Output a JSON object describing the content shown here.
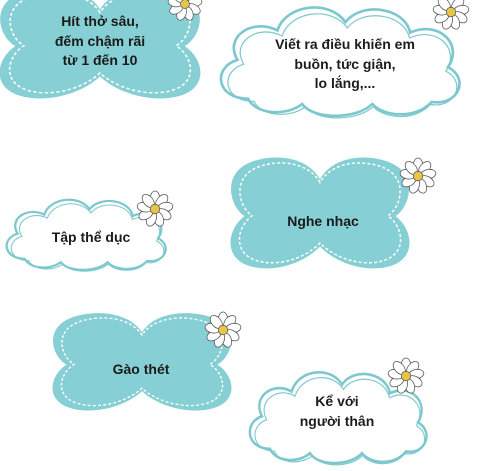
{
  "colors": {
    "butterfly_fill": "#86cfd4",
    "cloud_outline": "#7cc8ce",
    "dash": "#ffffff",
    "flower_petal": "#ffffff",
    "flower_center": "#e6c64a"
  },
  "items": [
    {
      "shape": "butterfly",
      "text": "Hít thở sâu,\nđếm chậm rãi\ntừ 1 đến 10"
    },
    {
      "shape": "cloud",
      "text": "Viết ra điều khiến em\nbuồn, tức giận,\nlo lắng,..."
    },
    {
      "shape": "cloud",
      "text": "Tập thể dục"
    },
    {
      "shape": "butterfly",
      "text": "Nghe nhạc"
    },
    {
      "shape": "butterfly",
      "text": "Gào thét"
    },
    {
      "shape": "cloud",
      "text": "Kể với\nngười thân"
    }
  ]
}
